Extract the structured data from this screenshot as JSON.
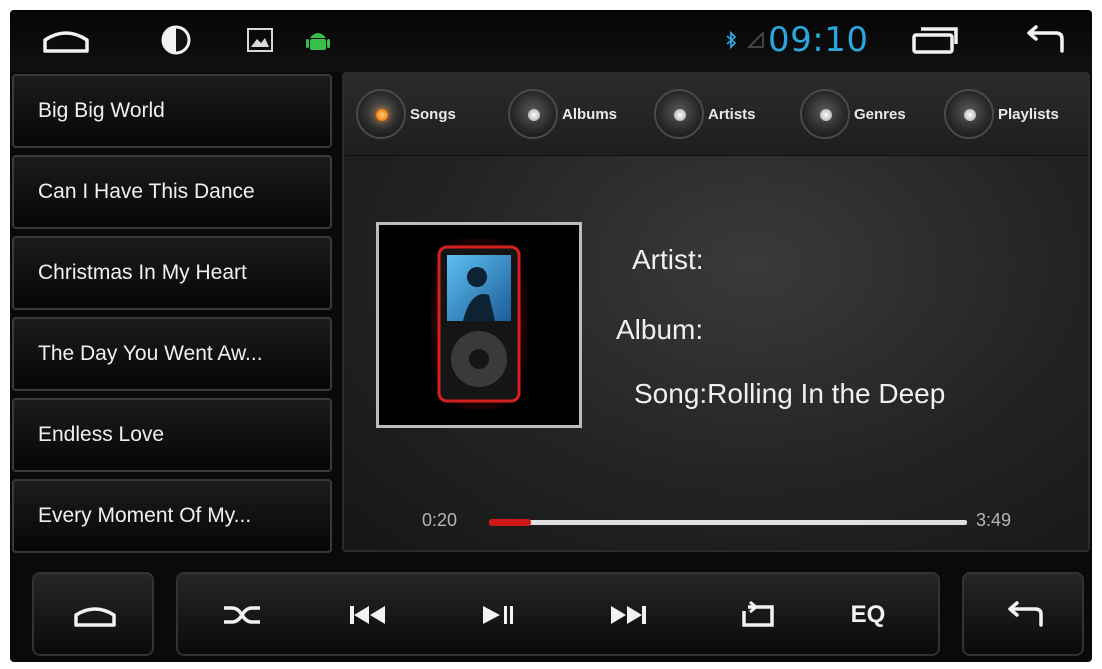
{
  "statusbar": {
    "time": "09:10",
    "icons": [
      "home-icon",
      "brightness-icon",
      "image-icon",
      "android-icon",
      "bluetooth-icon",
      "signal-icon",
      "recent-apps-icon",
      "back-icon"
    ]
  },
  "songs": [
    {
      "title": "Big Big World"
    },
    {
      "title": "Can I Have This Dance"
    },
    {
      "title": "Christmas In My Heart"
    },
    {
      "title": "The Day You Went Aw..."
    },
    {
      "title": "Endless Love"
    },
    {
      "title": "Every Moment Of My..."
    }
  ],
  "categories": [
    {
      "label": "Songs",
      "active": true
    },
    {
      "label": "Albums",
      "active": false
    },
    {
      "label": "Artists",
      "active": false
    },
    {
      "label": "Genres",
      "active": false
    },
    {
      "label": "Playlists",
      "active": false
    }
  ],
  "now_playing": {
    "artist_label": "Artist:",
    "album_label": "Album:",
    "song_label": "Song:Rolling In the Deep",
    "current_time": "0:20",
    "total_time": "3:49",
    "progress": 0.087
  },
  "controls": {
    "eq_label": "EQ",
    "icons": [
      "home-icon",
      "shuffle-icon",
      "previous-icon",
      "play-pause-icon",
      "next-icon",
      "repeat-icon",
      "back-icon"
    ]
  },
  "colors": {
    "accent_blue": "#2aa7dc",
    "progress_red": "#d01818",
    "active_orange": "#f58a1f"
  }
}
